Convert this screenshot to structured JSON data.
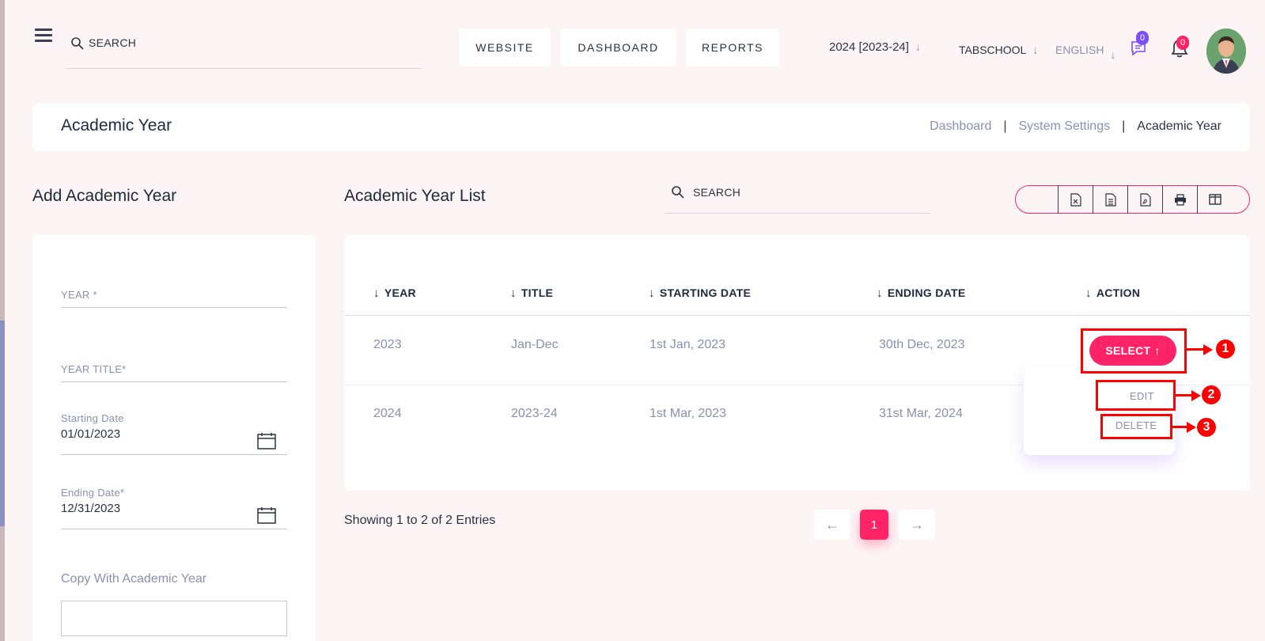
{
  "header": {
    "search_placeholder": "SEARCH",
    "nav": {
      "website": "WEBSITE",
      "dashboard": "DASHBOARD",
      "reports": "REPORTS"
    },
    "academic_year_select": "2024 [2023-24]",
    "school_select": "TABSCHOOL",
    "language_select": "ENGLISH",
    "messages_count": "0",
    "notifications_count": "0"
  },
  "page": {
    "title": "Academic Year",
    "breadcrumb": [
      "Dashboard",
      "System Settings",
      "Academic Year"
    ],
    "separator": "|"
  },
  "form": {
    "title": "Add Academic Year",
    "year_label": "YEAR *",
    "year_title_label": "YEAR TITLE*",
    "starting_date_label": "Starting Date",
    "starting_date_value": "01/01/2023",
    "ending_date_label": "Ending Date*",
    "ending_date_value": "12/31/2023",
    "copy_label": "Copy With Academic Year"
  },
  "list": {
    "title": "Academic Year List",
    "search_placeholder": "SEARCH",
    "export_icons": [
      "excel-icon",
      "csv-icon",
      "pdf-icon",
      "print-icon",
      "columns-icon"
    ],
    "columns": [
      "YEAR",
      "TITLE",
      "STARTING DATE",
      "ENDING DATE",
      "ACTION"
    ],
    "rows": [
      {
        "year": "2023",
        "title": "Jan-Dec",
        "start": "1st Jan, 2023",
        "end": "30th Dec, 2023"
      },
      {
        "year": "2024",
        "title": "2023-24",
        "start": "1st Mar, 2023",
        "end": "31st Mar, 2024"
      }
    ],
    "select_label": "SELECT",
    "menu": {
      "edit": "EDIT",
      "delete": "DELETE"
    },
    "showing": "Showing 1 to 2 of 2 Entries",
    "current_page": "1"
  },
  "annotations": [
    "1",
    "2",
    "3"
  ],
  "colors": {
    "accent": "#ff2468",
    "purple": "#7c4dff",
    "annotation": "#ff0000"
  }
}
